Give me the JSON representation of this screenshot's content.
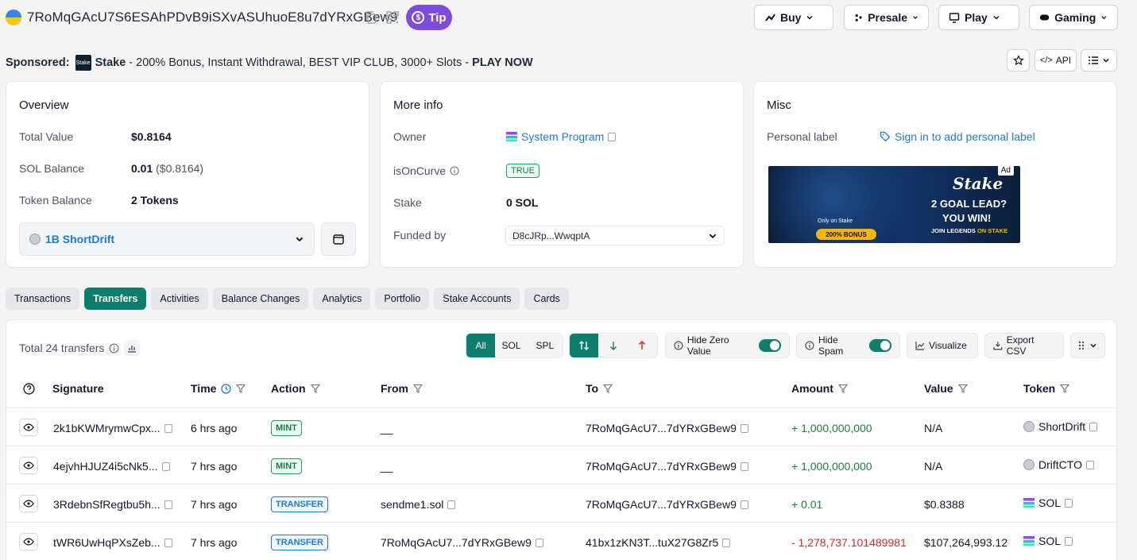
{
  "header": {
    "address": "7RoMqGAcU7S6ESAhPDvB9iSXvASUhuoE8u7dYRxGBew9",
    "tip_label": "Tip",
    "nav": [
      {
        "label": "Buy",
        "icon": "chart-icon"
      },
      {
        "label": "Presale",
        "icon": "dots-icon"
      },
      {
        "label": "Play",
        "icon": "monitor-icon"
      },
      {
        "label": "Gaming",
        "icon": "gamepad-icon"
      }
    ]
  },
  "sponsored": {
    "label": "Sponsored:",
    "brand": "Stake",
    "text": " - 200% Bonus, Instant Withdrawal, BEST VIP CLUB, 3000+ Slots - ",
    "cta": "PLAY NOW"
  },
  "toolbar": {
    "api_label": "API"
  },
  "overview": {
    "title": "Overview",
    "total_value_label": "Total Value",
    "total_value": "$0.8164",
    "sol_balance_label": "SOL Balance",
    "sol_balance": "0.01",
    "sol_balance_usd": "($0.8164)",
    "token_balance_label": "Token Balance",
    "token_balance": "2 Tokens",
    "token_select": "1B ShortDrift"
  },
  "more_info": {
    "title": "More info",
    "owner_label": "Owner",
    "owner": "System Program",
    "is_on_curve_label": "isOnCurve",
    "is_on_curve": "TRUE",
    "stake_label": "Stake",
    "stake": "0 SOL",
    "funded_by_label": "Funded by",
    "funded_by": "D8cJRp...WwqptA"
  },
  "misc": {
    "title": "Misc",
    "personal_label_label": "Personal label",
    "personal_label_link": "Sign in to add personal label",
    "ad_tag": "Ad",
    "ad_brand": "Stake",
    "ad_line1": "2 GOAL LEAD?",
    "ad_line2": "YOU WIN!",
    "ad_line3a": "JOIN LEGENDS ",
    "ad_line3b": "ON STAKE",
    "ad_bonus": "200% BONUS",
    "ad_small": "Only on Stake"
  },
  "tabs": [
    "Transactions",
    "Transfers",
    "Activities",
    "Balance Changes",
    "Analytics",
    "Portfolio",
    "Stake Accounts",
    "Cards"
  ],
  "transfers": {
    "total_label": "Total 24 transfers",
    "filter_type": [
      "All",
      "SOL",
      "SPL"
    ],
    "hide_zero_label": "Hide Zero Value",
    "hide_spam_label": "Hide Spam",
    "visualize_label": "Visualize",
    "export_label": "Export CSV",
    "columns": [
      "Signature",
      "Time",
      "Action",
      "From",
      "To",
      "Amount",
      "Value",
      "Token"
    ],
    "rows": [
      {
        "signature": "2k1bKWMrymwCpx...",
        "time": "6 hrs ago",
        "action": "MINT",
        "from": "__",
        "to": "7RoMqGAcU7...7dYRxGBew9",
        "amount": "+ 1,000,000,000",
        "value": "N/A",
        "token": "ShortDrift"
      },
      {
        "signature": "4ejvhHJUZ4i5cNk5...",
        "time": "7 hrs ago",
        "action": "MINT",
        "from": "__",
        "to": "7RoMqGAcU7...7dYRxGBew9",
        "amount": "+ 1,000,000,000",
        "value": "N/A",
        "token": "DriftCTO"
      },
      {
        "signature": "3RdebnSfRegtbu5h...",
        "time": "7 hrs ago",
        "action": "TRANSFER",
        "from": "sendme1.sol",
        "to": "7RoMqGAcU7...7dYRxGBew9",
        "amount": "+ 0.01",
        "value": "$0.8388",
        "token": "SOL"
      },
      {
        "signature": "tWR6UwHqPXsZeb...",
        "time": "7 hrs ago",
        "action": "TRANSFER",
        "from": "7RoMqGAcU7...7dYRxGBew9",
        "to": "41bx1zKN3T...tuX27G8Zr5",
        "amount": "- 1,278,737.101489981",
        "value": "$107,264,993.12",
        "token": "SOL"
      }
    ]
  },
  "colors": {
    "accent": "#0d7d6c",
    "link": "#1e7ad6",
    "tip": "#7c4ddc",
    "positive": "#15803d",
    "negative": "#dc2626"
  }
}
